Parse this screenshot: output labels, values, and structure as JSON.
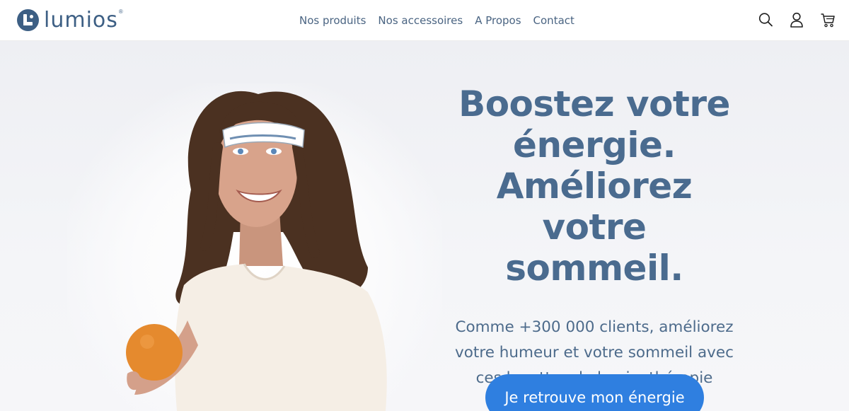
{
  "brand": {
    "name": "lumios",
    "reg": "®",
    "color": "#3d5f84"
  },
  "nav": {
    "items": [
      {
        "label": "Nos produits"
      },
      {
        "label": "Nos accessoires"
      },
      {
        "label": "A Propos"
      },
      {
        "label": "Contact"
      }
    ]
  },
  "header_icons": [
    "search-icon",
    "account-icon",
    "cart-icon"
  ],
  "hero": {
    "headline": [
      "Boostez votre",
      "énergie.",
      "Améliorez votre",
      "sommeil."
    ],
    "subtitle": [
      "Comme +300 000 clients, améliorez",
      "votre humeur et votre sommeil avec",
      "ces lunettes de luminothérapie"
    ],
    "cta_label": "Je retrouve mon énergie",
    "colors": {
      "headline": "#4a6b8f",
      "cta": "#2f7fe0"
    }
  }
}
